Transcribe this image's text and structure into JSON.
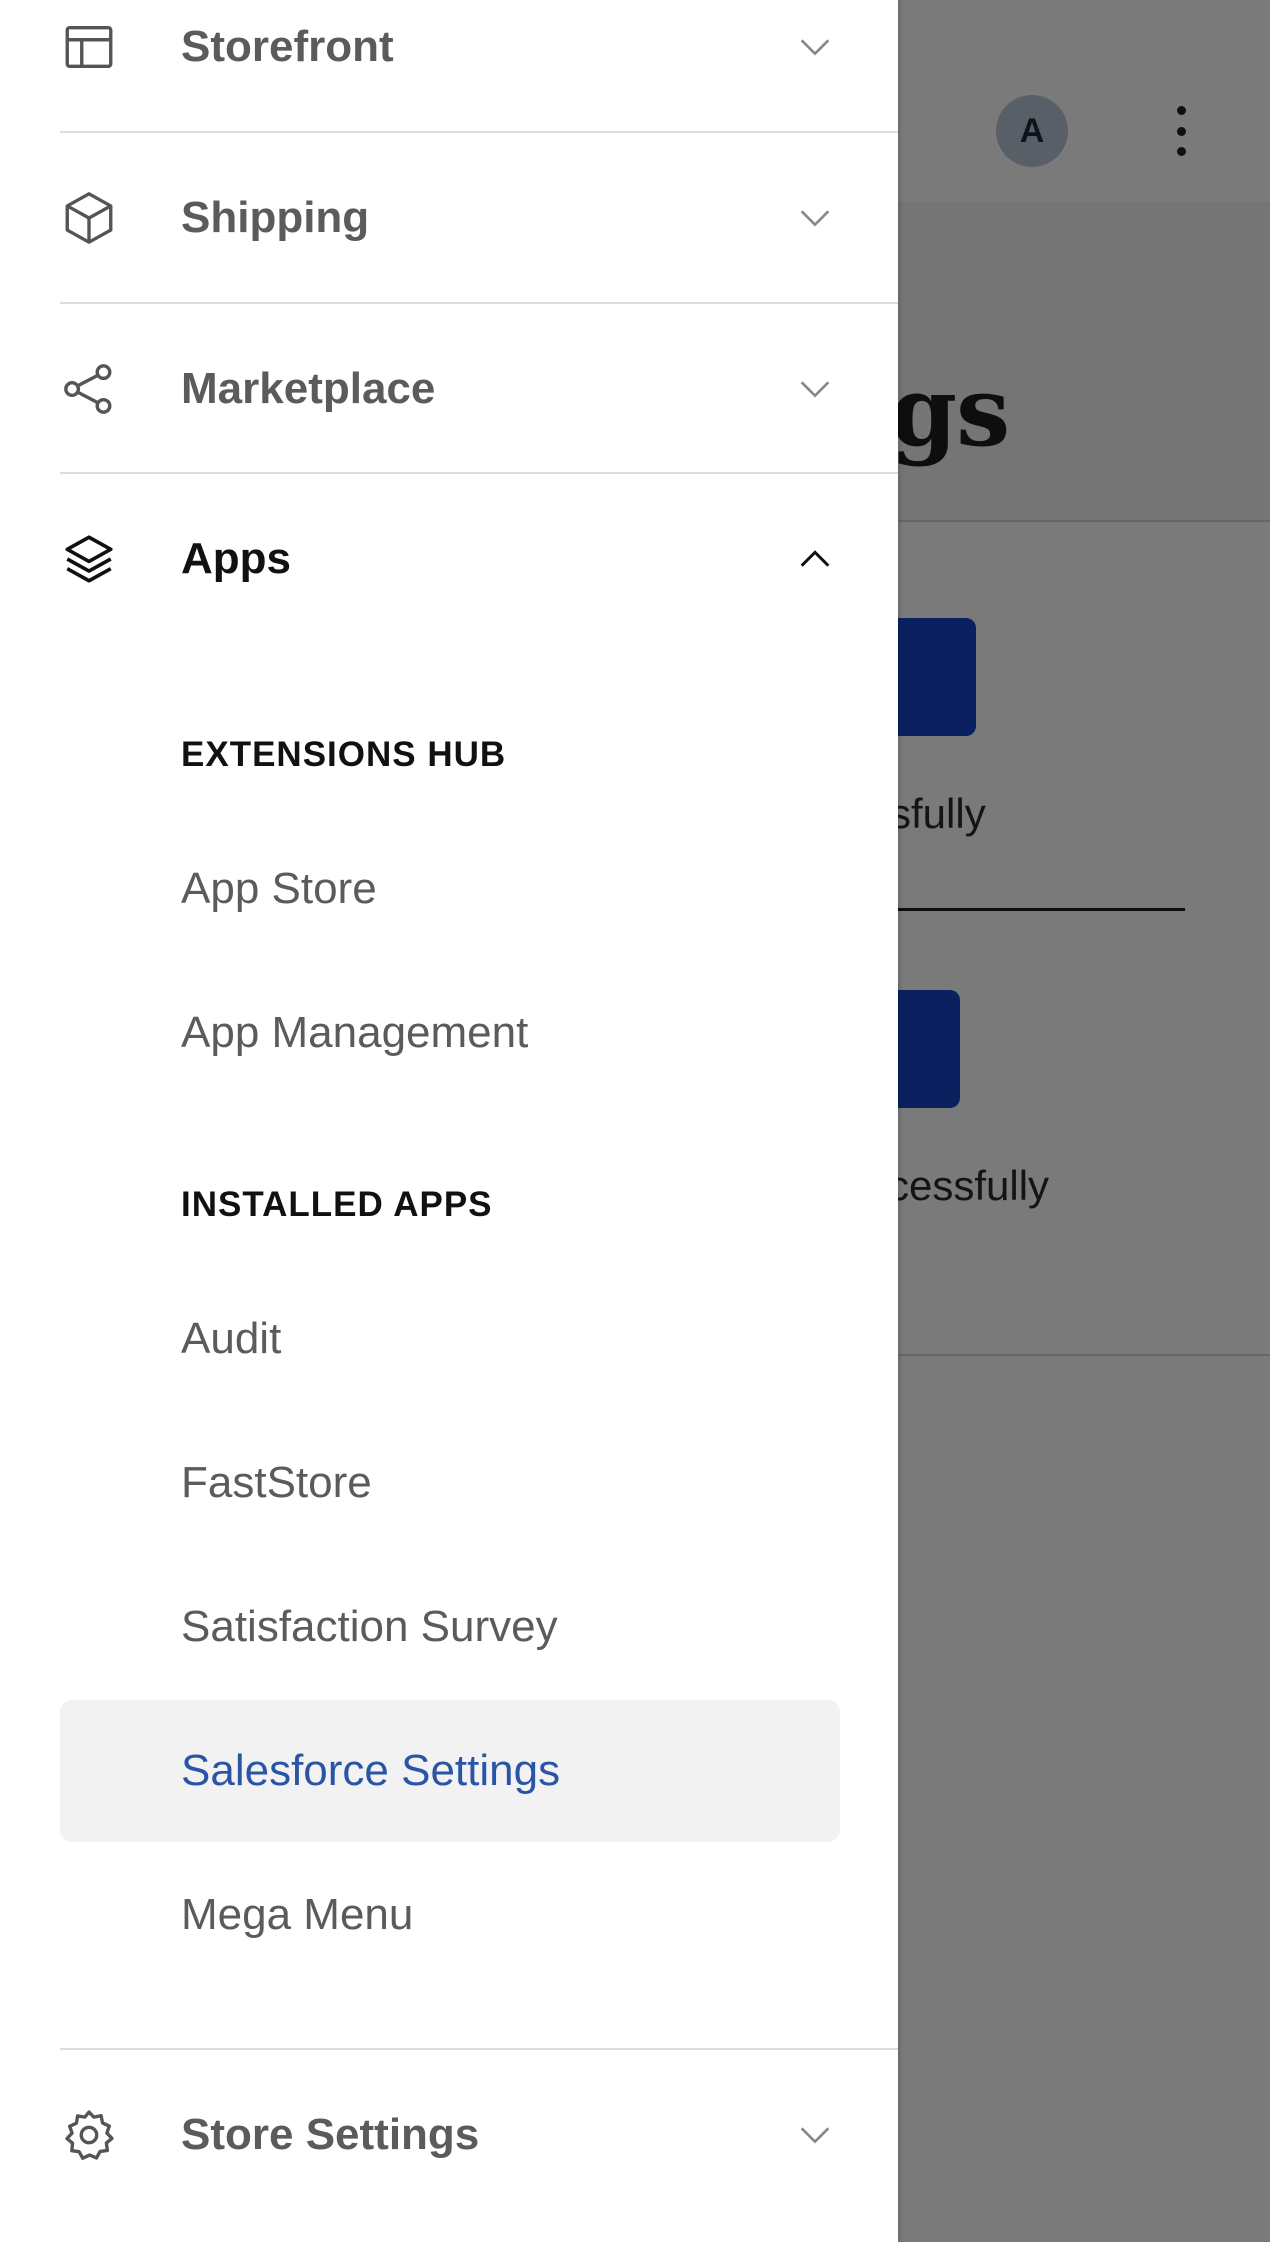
{
  "background": {
    "avatar_initial": "A",
    "title_fragment": "gs",
    "status_1_fragment": "sfully",
    "status_2_fragment": "cessfully"
  },
  "nav": {
    "storefront": {
      "label": "Storefront",
      "icon": "layout-icon",
      "expanded": false
    },
    "shipping": {
      "label": "Shipping",
      "icon": "box-icon",
      "expanded": false
    },
    "marketplace": {
      "label": "Marketplace",
      "icon": "share-icon",
      "expanded": false
    },
    "apps": {
      "label": "Apps",
      "icon": "layers-icon",
      "expanded": true,
      "sections": [
        {
          "heading": "EXTENSIONS HUB",
          "items": [
            "App Store",
            "App Management"
          ]
        },
        {
          "heading": "INSTALLED APPS",
          "items": [
            "Audit",
            "FastStore",
            "Satisfaction Survey",
            "Salesforce Settings",
            "Mega Menu"
          ]
        }
      ],
      "selected_item": "Salesforce Settings"
    },
    "store_settings": {
      "label": "Store Settings",
      "icon": "gear-icon",
      "expanded": false
    }
  },
  "colors": {
    "selected_text": "#2a55a6",
    "selected_bg": "#f2f2f2",
    "background_button": "#1745c6"
  }
}
